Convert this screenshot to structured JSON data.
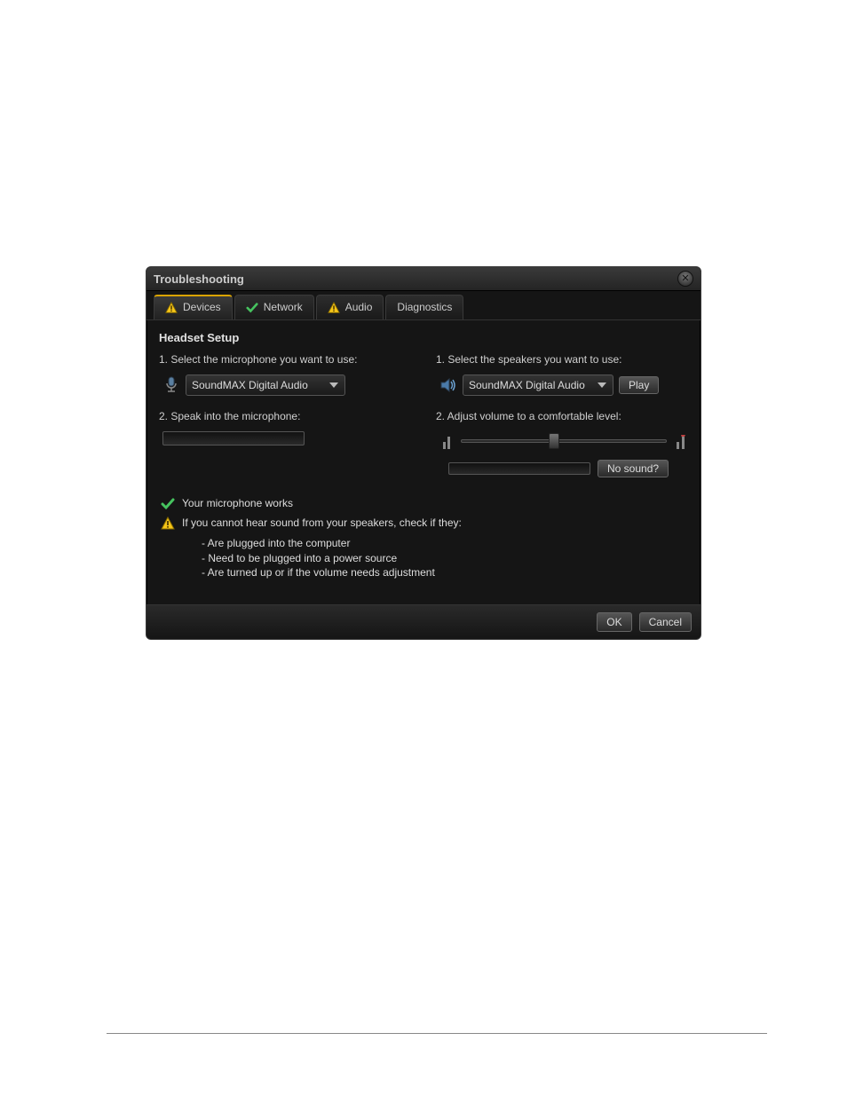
{
  "dialog": {
    "title": "Troubleshooting",
    "tabs": [
      {
        "label": "Devices",
        "icon": "warning"
      },
      {
        "label": "Network",
        "icon": "check"
      },
      {
        "label": "Audio",
        "icon": "warning"
      },
      {
        "label": "Diagnostics",
        "icon": "none"
      }
    ],
    "active_tab": 0,
    "section_title": "Headset Setup",
    "mic": {
      "step1_label": "1. Select the microphone you want to use:",
      "selected": "SoundMAX Digital Audio",
      "step2_label": "2. Speak into the microphone:"
    },
    "speakers": {
      "step1_label": "1. Select the speakers you want to use:",
      "selected": "SoundMAX Digital Audio",
      "play_label": "Play",
      "step2_label": "2. Adjust volume to a comfortable level:",
      "no_sound_label": "No sound?"
    },
    "status": {
      "ok_text": "Your microphone works",
      "warn_text": "If you cannot hear sound from your speakers, check if they:",
      "tips": [
        "- Are plugged into the computer",
        "- Need to be plugged into a power source",
        "- Are turned up or if the volume needs adjustment"
      ]
    },
    "footer": {
      "ok_label": "OK",
      "cancel_label": "Cancel"
    }
  }
}
